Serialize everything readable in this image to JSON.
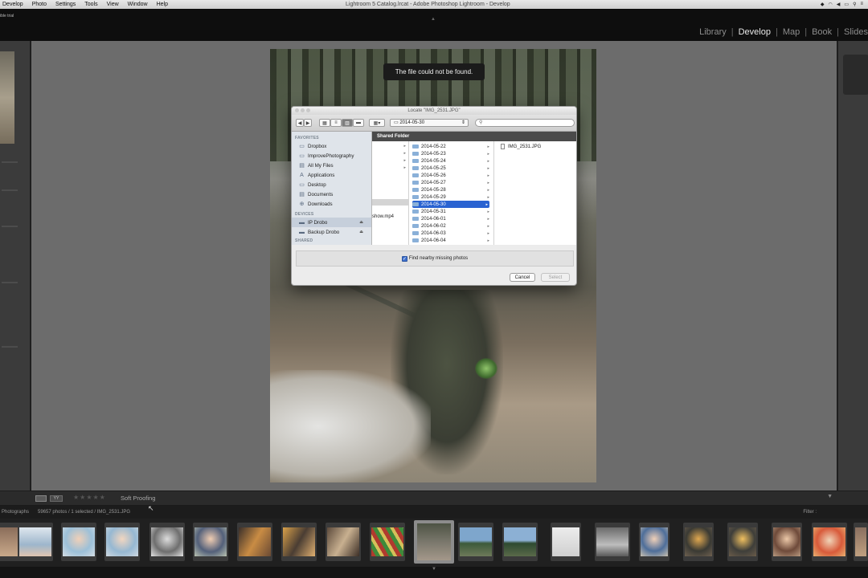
{
  "menubar": {
    "items": [
      "Develop",
      "Photo",
      "Settings",
      "Tools",
      "View",
      "Window",
      "Help"
    ],
    "title": "Lightroom 5 Catalog.lrcat - Adobe Photoshop Lightroom - Develop"
  },
  "topband": {
    "trial_text": "ible trial"
  },
  "modules": {
    "items": [
      "Library",
      "Develop",
      "Map",
      "Book",
      "Slides"
    ],
    "active": "Develop"
  },
  "toast": {
    "message": "The file could not be found."
  },
  "dialog": {
    "title": "Locate \"IMG_2531.JPG\"",
    "location_popup": "2014-05-30",
    "search_placeholder": "",
    "shared_folder_header": "Shared Folder",
    "sidebar": {
      "favorites_header": "FAVORITES",
      "favorites": [
        "Dropbox",
        "ImprovePhotography",
        "All My Files",
        "Applications",
        "Desktop",
        "Documents",
        "Downloads"
      ],
      "devices_header": "DEVICES",
      "devices": [
        "IP Drobo",
        "Backup Drobo"
      ],
      "selected_device": "IP Drobo",
      "shared_header": "SHARED"
    },
    "column1_file": "show.mp4",
    "folders": [
      "2014-05-22",
      "2014-05-23",
      "2014-05-24",
      "2014-05-25",
      "2014-05-26",
      "2014-05-27",
      "2014-05-28",
      "2014-05-29",
      "2014-05-30",
      "2014-05-31",
      "2014-06-01",
      "2014-06-02",
      "2014-06-03",
      "2014-06-04"
    ],
    "selected_folder": "2014-05-30",
    "file": "IMG_2531.JPG",
    "option_label": "Find nearby missing photos",
    "option_checked": true,
    "cancel_label": "Cancel",
    "select_label": "Select"
  },
  "toolbar": {
    "soft_proofing": "Soft Proofing",
    "stars": "★★★★★"
  },
  "filmstrip_bar": {
    "source": "Photographs",
    "count": "59657 photos / 1 selected / IMG_2531.JPG",
    "filter": "Filter :"
  },
  "colors": {
    "accent": "#2a63d1",
    "panel": "#3b3b3b",
    "background": "#6c6c6c"
  }
}
